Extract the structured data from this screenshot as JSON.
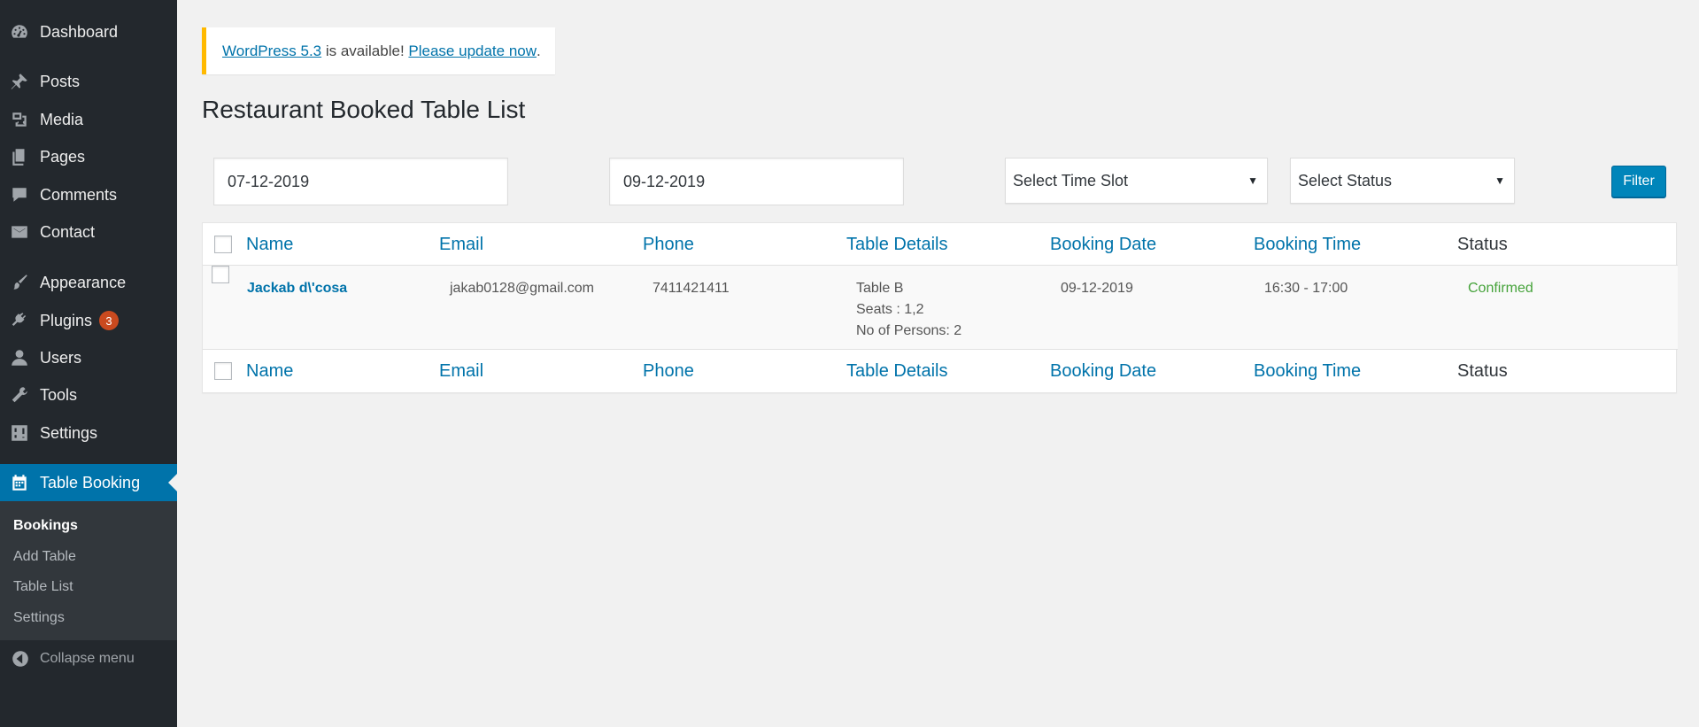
{
  "sidebar": {
    "items": [
      {
        "label": "Dashboard"
      },
      {
        "label": "Posts"
      },
      {
        "label": "Media"
      },
      {
        "label": "Pages"
      },
      {
        "label": "Comments"
      },
      {
        "label": "Contact"
      },
      {
        "label": "Appearance"
      },
      {
        "label": "Plugins",
        "badge": "3"
      },
      {
        "label": "Users"
      },
      {
        "label": "Tools"
      },
      {
        "label": "Settings"
      },
      {
        "label": "Table Booking"
      }
    ],
    "submenu": [
      "Bookings",
      "Add Table",
      "Table List",
      "Settings"
    ],
    "collapse_label": "Collapse menu"
  },
  "notice": {
    "link1": "WordPress 5.3",
    "middle": " is available! ",
    "link2": "Please update now",
    "end": "."
  },
  "page_title": "Restaurant Booked Table List",
  "filters": {
    "start_date": "07-12-2019",
    "end_date": "09-12-2019",
    "time_slot": "Select Time Slot",
    "status": "Select Status",
    "filter_label": "Filter"
  },
  "table": {
    "columns": [
      "Name",
      "Email",
      "Phone",
      "Table Details",
      "Booking Date",
      "Booking Time",
      "Status"
    ],
    "rows": [
      {
        "name": "Jackab d\\'cosa",
        "email": "jakab0128@gmail.com",
        "phone": "7411421411",
        "table": "Table B",
        "seats": "Seats : 1,2",
        "persons": "No of Persons: 2",
        "date": "09-12-2019",
        "time": "16:30 - 17:00",
        "status": "Confirmed"
      }
    ]
  },
  "colors": {
    "sidebar_bg": "#23282d",
    "accent": "#0073aa",
    "notice_border": "#ffb900",
    "badge": "#ca4a1f",
    "confirmed": "#46a33b"
  }
}
